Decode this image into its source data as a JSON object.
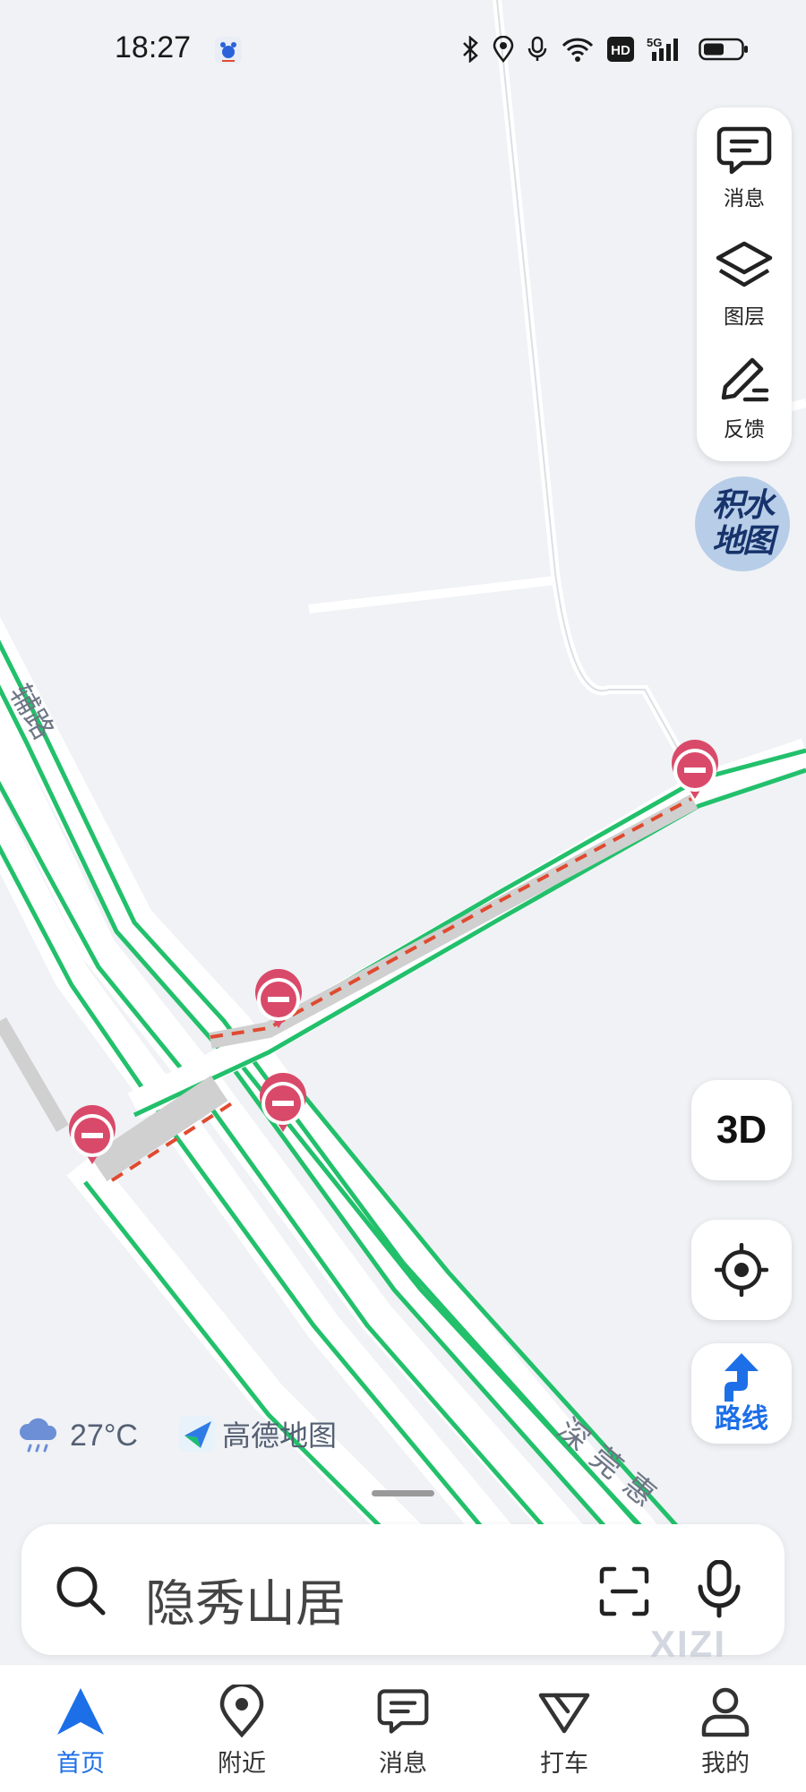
{
  "status_bar": {
    "time": "18:27",
    "icons": [
      "bluetooth-icon",
      "location-icon",
      "microphone-icon",
      "wifi-icon",
      "hd-icon",
      "signal-5g-icon",
      "battery-icon"
    ],
    "hd_label": "HD",
    "network_label": "5G"
  },
  "map": {
    "road_labels": [
      "辅路",
      "深莞惠"
    ],
    "incident_markers": 4,
    "colors": {
      "road_green": "#22c06b",
      "closure_red": "#e04a2f",
      "marker_pink": "#d94a6a",
      "background": "#f0f2f5"
    }
  },
  "side_panel": {
    "items": [
      {
        "label": "消息",
        "icon": "message-icon"
      },
      {
        "label": "图层",
        "icon": "layers-icon"
      },
      {
        "label": "反馈",
        "icon": "edit-feedback-icon"
      }
    ]
  },
  "water_map": {
    "line1": "积水",
    "line2": "地图"
  },
  "controls": {
    "btn_3d": "3D",
    "route_label": "路线"
  },
  "weather": {
    "temp": "27°C",
    "icon": "rain-cloud-icon"
  },
  "brand": {
    "name": "高德地图",
    "icon": "amap-logo-icon"
  },
  "search": {
    "placeholder": "隐秀山居"
  },
  "tabs": [
    {
      "label": "首页",
      "icon": "navigation-arrow-icon",
      "active": true
    },
    {
      "label": "附近",
      "icon": "location-pin-icon",
      "active": false
    },
    {
      "label": "消息",
      "icon": "message-icon",
      "active": false
    },
    {
      "label": "打车",
      "icon": "taxi-icon",
      "active": false
    },
    {
      "label": "我的",
      "icon": "user-icon",
      "active": false
    }
  ],
  "watermark": "XIZI",
  "accent_color": "#1d6fe8"
}
